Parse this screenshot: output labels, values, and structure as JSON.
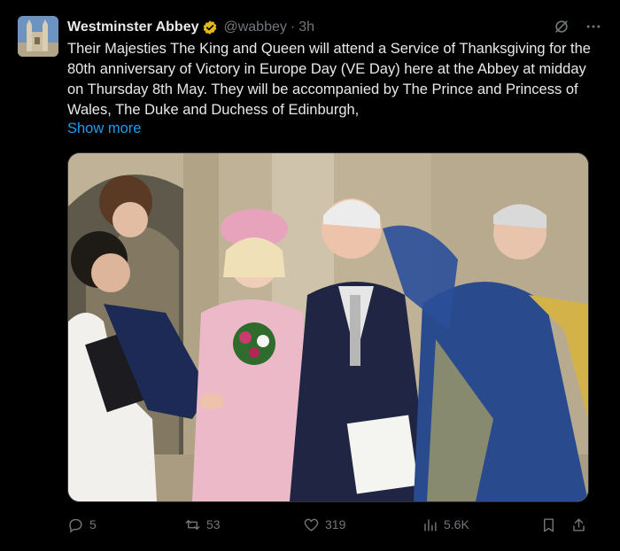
{
  "account": {
    "name": "Westminster Abbey",
    "handle": "@wabbey",
    "time": "3h"
  },
  "tweet": {
    "text": "Their Majesties The King and Queen will attend a Service of Thanksgiving for the 80th anniversary of Victory in Europe  Day (VE Day) here at the Abbey at midday on Thursday 8th May. They will be accompanied by The Prince and Princess of Wales, The Duke and Duchess of Edinburgh,",
    "show_more": "Show more"
  },
  "icons": {
    "verified": "verified-badge-icon",
    "grok": "grok-icon",
    "more": "more-icon",
    "reply": "reply-icon",
    "retweet": "retweet-icon",
    "like": "like-icon",
    "views": "views-icon",
    "bookmark": "bookmark-icon",
    "share": "share-icon"
  },
  "actions": {
    "replies": "5",
    "retweets": "53",
    "likes": "319",
    "views": "5.6K"
  },
  "colors": {
    "background": "#000000",
    "text": "#e7e9ea",
    "muted": "#71767b",
    "link": "#1d9bf0",
    "verified": "#e2b719"
  }
}
